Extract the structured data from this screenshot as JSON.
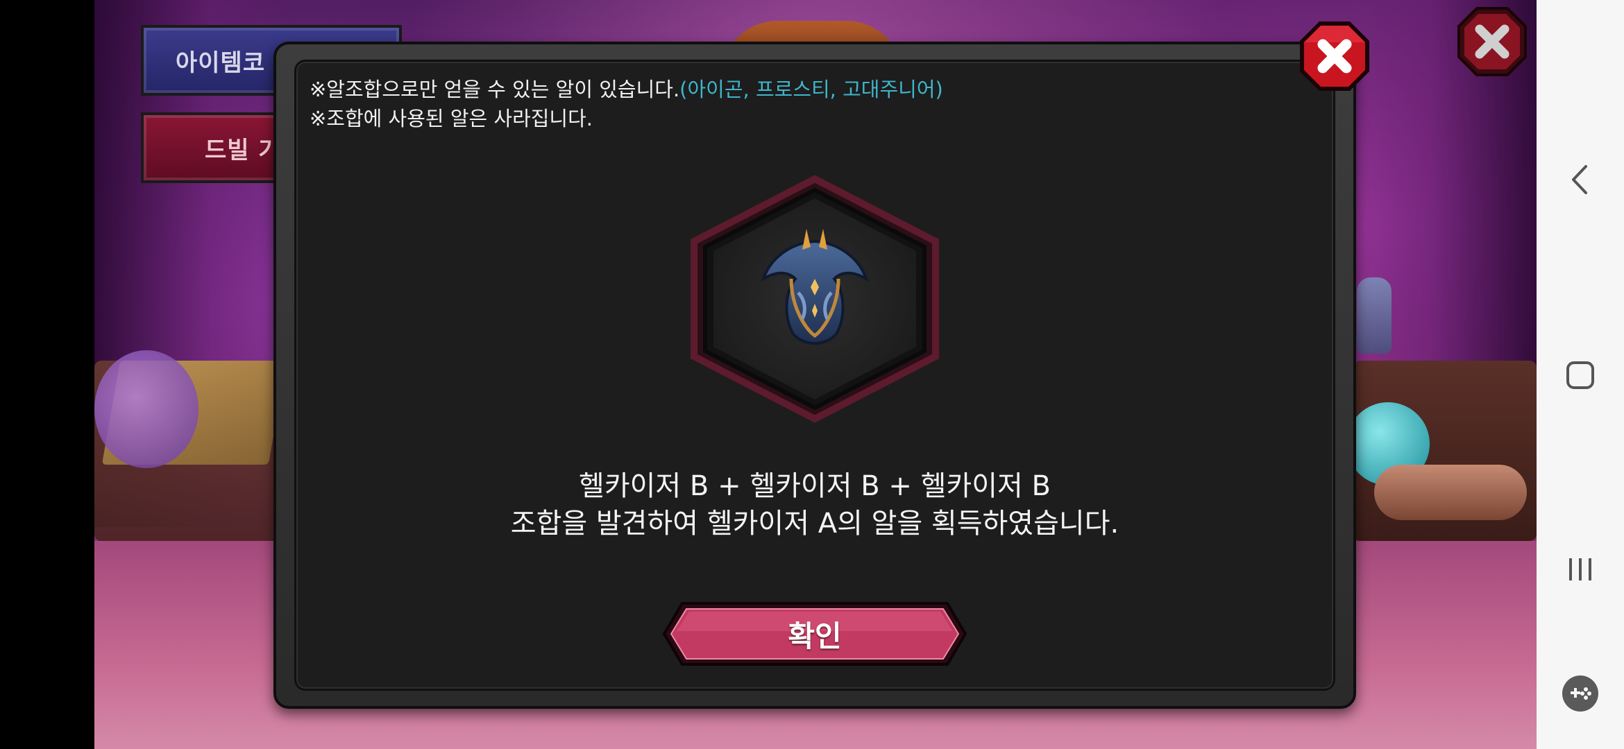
{
  "background": {
    "side_buttons": {
      "item_code_label": "아이템코",
      "drill_label": "드빌 가"
    }
  },
  "dialog": {
    "notice_line1_prefix": "※알조합으로만 얻을 수 있는 알이 있습니다.",
    "notice_line1_highlight": "(아이곤, 프로스티, 고대주니어)",
    "notice_line2": "※조합에 사용된 알은 사라집니다.",
    "result_line1": "헬카이저 B + 헬카이저 B + 헬카이저 B",
    "result_line2": "조합을 발견하여 헬카이저 A의 알을 획득하였습니다.",
    "confirm_label": "확인",
    "egg_icon": "hellkaiser-egg-icon"
  },
  "colors": {
    "highlight_text": "#3fb6cc",
    "confirm_button": "#c23a62",
    "close_button_red": "#d41b2e",
    "dialog_bg": "#1d1d1d",
    "hex_border": "#5e1b2e"
  },
  "system_nav": {
    "back_icon": "back-icon",
    "home_icon": "home-icon",
    "recent_icon": "recent-apps-icon",
    "game_icon": "game-tools-icon"
  }
}
